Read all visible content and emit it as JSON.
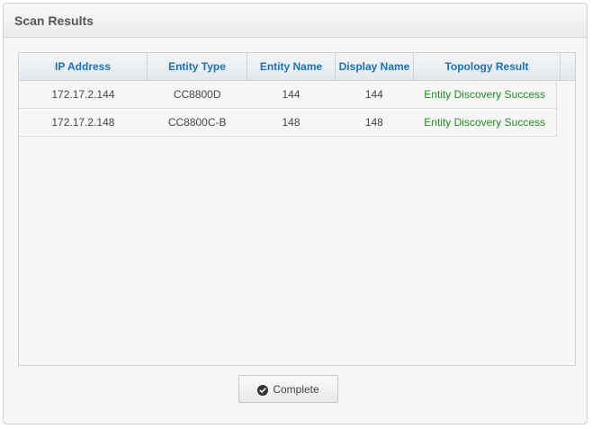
{
  "panel": {
    "title": "Scan Results"
  },
  "grid": {
    "columns": [
      "IP Address",
      "Entity Type",
      "Entity Name",
      "Display Name",
      "Topology Result"
    ],
    "rows": [
      {
        "ip": "172.17.2.144",
        "type": "CC8800D",
        "name": "144",
        "display": "144",
        "result": "Entity Discovery Success"
      },
      {
        "ip": "172.17.2.148",
        "type": "CC8800C-B",
        "name": "148",
        "display": "148",
        "result": "Entity Discovery Success"
      }
    ]
  },
  "actions": {
    "complete_label": "Complete",
    "complete_icon": "check-circle-icon"
  },
  "colors": {
    "header_text": "#1b72b9",
    "success_text": "#1f8c1f"
  }
}
